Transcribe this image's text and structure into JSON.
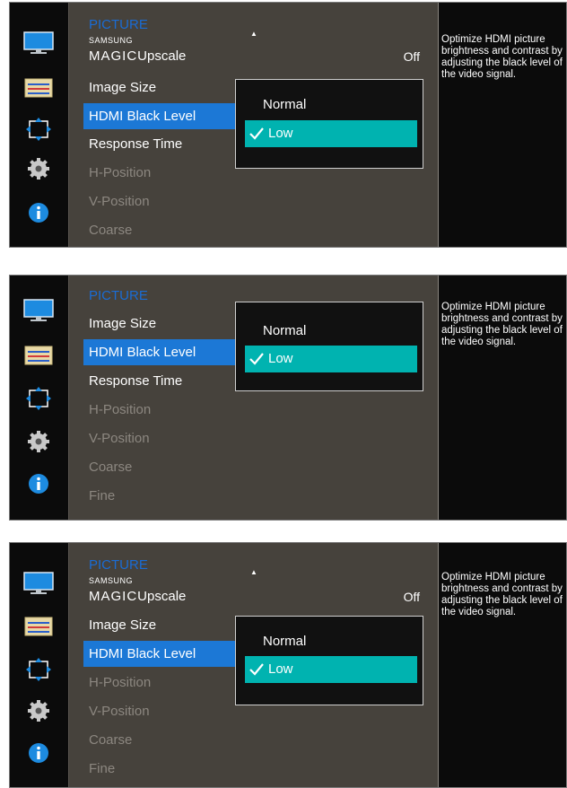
{
  "screens": [
    {
      "menu": {
        "header": "PICTURE",
        "magic_small": "SAMSUNG",
        "magic_big": "MAGIC",
        "magic_name": "Upscale",
        "magic_value": "Off",
        "items": [
          "Image Size",
          "HDMI Black Level",
          "Response Time",
          "H-Position",
          "V-Position",
          "Coarse"
        ]
      },
      "dropdown": {
        "options": [
          "Normal",
          "Low"
        ],
        "selected": "Low"
      },
      "description": "Optimize HDMI picture brightness and contrast by adjusting the black level of the video signal."
    },
    {
      "menu": {
        "header": "PICTURE",
        "items": [
          "Image Size",
          "HDMI Black Level",
          "Response Time",
          "H-Position",
          "V-Position",
          "Coarse",
          "Fine"
        ]
      },
      "dropdown": {
        "options": [
          "Normal",
          "Low"
        ],
        "selected": "Low"
      },
      "description": "Optimize HDMI picture brightness and contrast by adjusting the black level of the video signal."
    },
    {
      "menu": {
        "header": "PICTURE",
        "magic_small": "SAMSUNG",
        "magic_big": "MAGIC",
        "magic_name": "Upscale",
        "magic_value": "Off",
        "items": [
          "Image Size",
          "HDMI Black Level",
          "H-Position",
          "V-Position",
          "Coarse",
          "Fine"
        ]
      },
      "dropdown": {
        "options": [
          "Normal",
          "Low"
        ],
        "selected": "Low"
      },
      "description": "Optimize HDMI picture brightness and contrast by adjusting the black level of the video signal."
    }
  ],
  "sidebar_icons": [
    "monitor-icon",
    "sliders-icon",
    "move-arrows-icon",
    "gear-icon",
    "info-icon"
  ],
  "colors": {
    "menu_bg": "#46423c",
    "selected_item": "#1c78d6",
    "selected_option": "#00b3b0",
    "header": "#1a6cd4",
    "disabled_text": "#8c8780"
  }
}
